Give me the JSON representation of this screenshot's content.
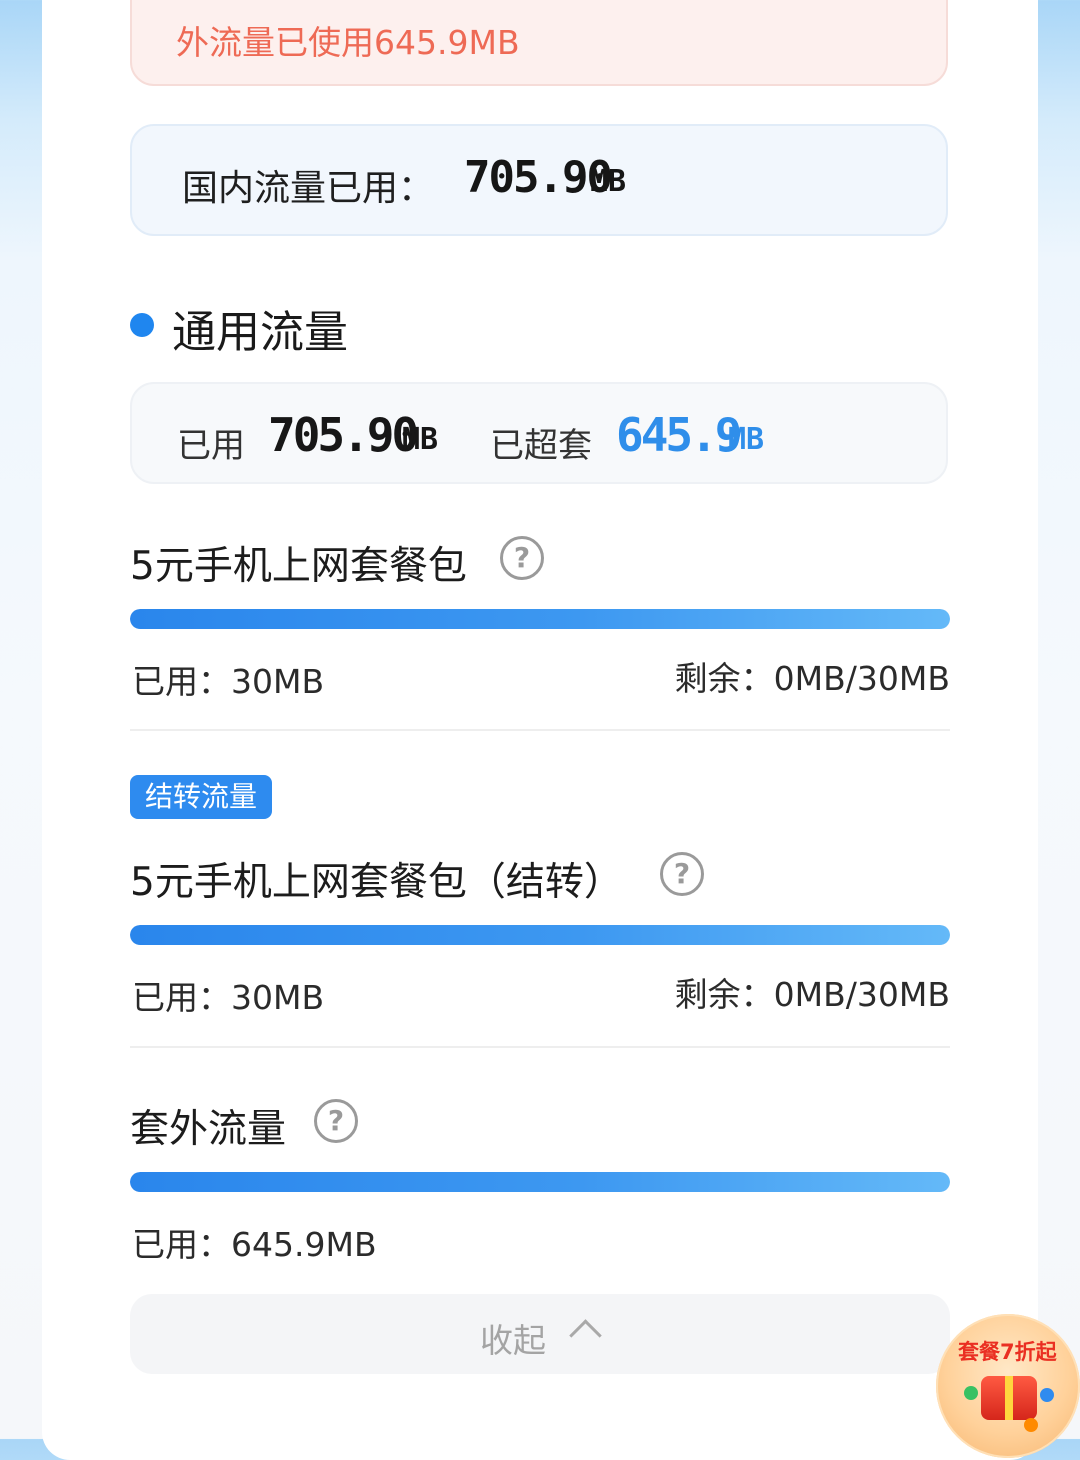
{
  "alert": {
    "text": "外流量已使用645.9MB"
  },
  "domestic": {
    "label": "国内流量已用：",
    "value": "705.90",
    "unit": "MB"
  },
  "general": {
    "title": "通用流量",
    "used_label": "已用",
    "used_value": "705.90",
    "used_unit": "MB",
    "over_label": "已超套",
    "over_value": "645.9",
    "over_unit": "MB"
  },
  "packages": [
    {
      "tag": "",
      "title": "5元手机上网套餐包",
      "used": "已用：30MB",
      "remain": "剩余：0MB/30MB",
      "fill": 1
    },
    {
      "tag": "结转流量",
      "title": "5元手机上网套餐包（结转）",
      "used": "已用：30MB",
      "remain": "剩余：0MB/30MB",
      "fill": 1
    },
    {
      "tag": "",
      "title": "套外流量",
      "used": "已用：645.9MB",
      "remain": "",
      "fill": 1
    }
  ],
  "help_icon": "?",
  "collapse": {
    "label": "收起"
  },
  "promo": {
    "label": "套餐7折起"
  },
  "colors": {
    "accent": "#1f86ef",
    "alert_text": "#ee6a55",
    "over_value": "#2f8eea"
  }
}
